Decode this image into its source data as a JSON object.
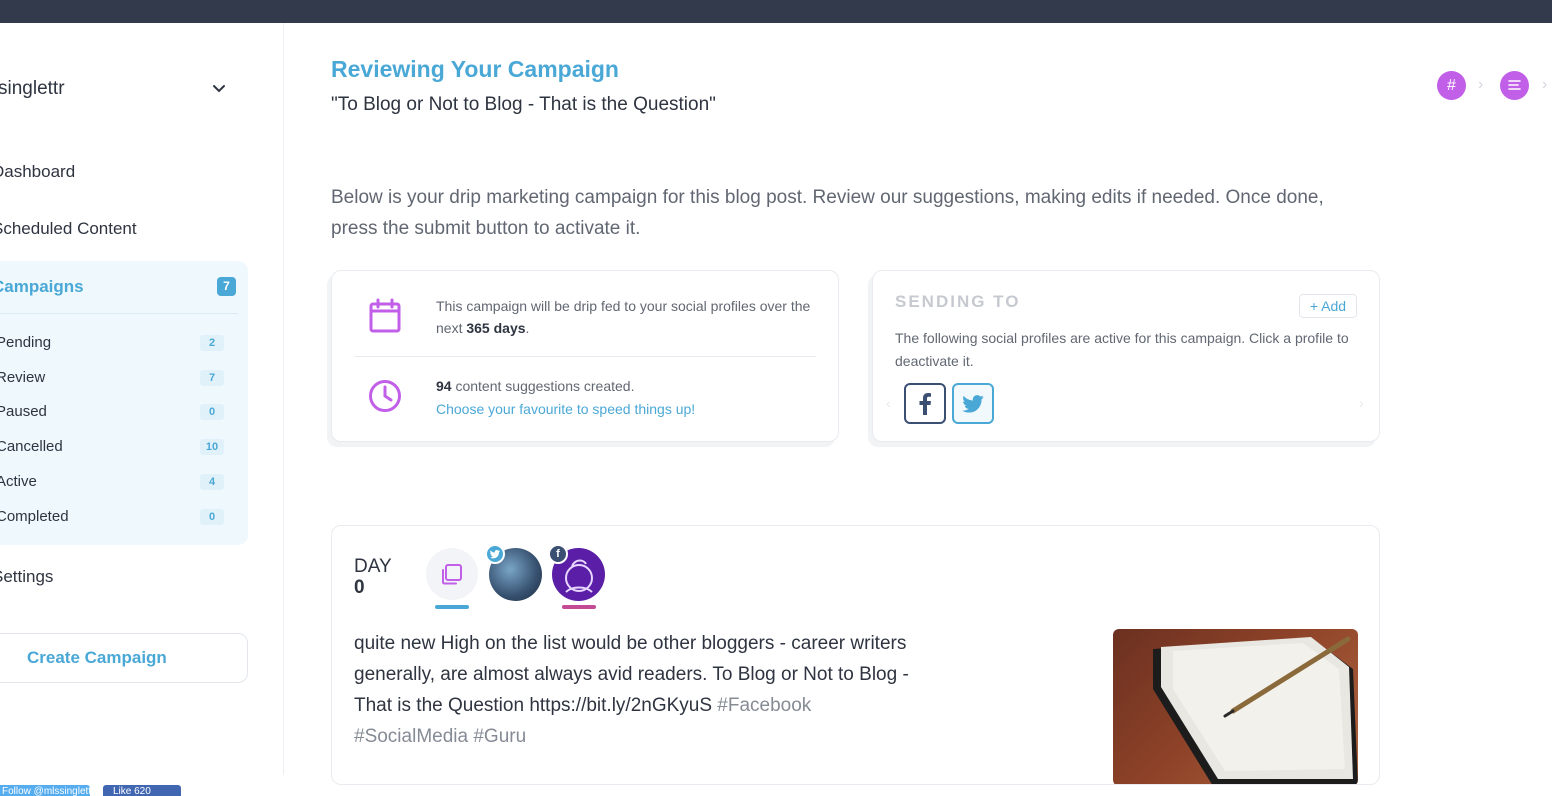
{
  "sidebar": {
    "org_name": "singlettr",
    "nav": {
      "dashboard": "Dashboard",
      "scheduled": "Scheduled Content",
      "campaigns": "Campaigns",
      "campaigns_count": "7",
      "settings": "Settings"
    },
    "campaign_filters": [
      {
        "label": "Pending",
        "count": "2"
      },
      {
        "label": "Review",
        "count": "7"
      },
      {
        "label": "Paused",
        "count": "0"
      },
      {
        "label": "Cancelled",
        "count": "10"
      },
      {
        "label": "Active",
        "count": "4"
      },
      {
        "label": "Completed",
        "count": "0"
      }
    ],
    "create_button": "Create Campaign",
    "badges": {
      "twitter": "Follow @mlssinglettr",
      "facebook": "Like 620"
    }
  },
  "main": {
    "title": "Reviewing Your Campaign",
    "subtitle": "\"To Blog or Not to Blog - That is the Question\"",
    "intro": "Below is your drip marketing campaign for this blog post. Review our suggestions, making edits if needed. Once done, press the submit button to activate it.",
    "steps": {
      "hash": "#"
    },
    "drip": {
      "prefix": "This campaign will be drip fed to your social profiles over the next ",
      "days": "365 days",
      "suffix": "."
    },
    "suggestions": {
      "count": "94",
      "text": " content suggestions created.",
      "link": "Choose your favourite to speed things up!"
    },
    "sending": {
      "title": "SENDING TO",
      "add_button": "+ Add",
      "description": "The following social profiles are active for this campaign. Click a profile to deactivate it."
    },
    "day_card": {
      "day_label": "DAY",
      "day_number": "0",
      "post_text": "quite new High on the list would be other bloggers - career writers generally, are almost always avid readers. To Blog or Not to Blog - That is the Question https://bit.ly/2nGKyuS",
      "hashtags": " #Facebook #SocialMedia #Guru"
    }
  },
  "colors": {
    "accent": "#4aa8d6",
    "purple": "#c15fe8",
    "topbar": "#333a4b"
  }
}
